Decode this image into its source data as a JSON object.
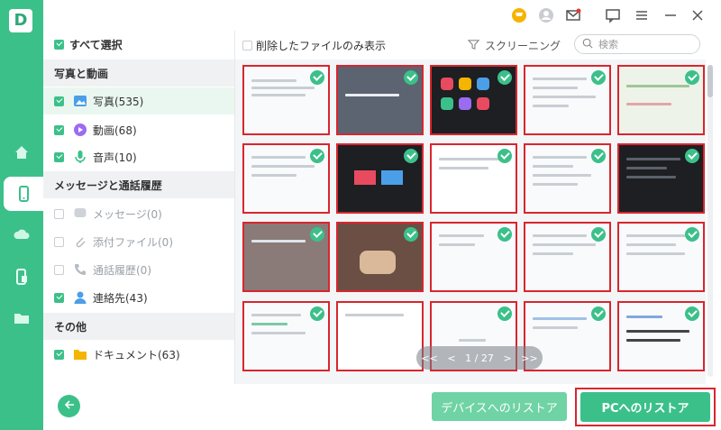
{
  "logo": "D",
  "sidebar": {
    "select_all": "すべて選択",
    "section_media": "写真と動画",
    "photos": "写真(535)",
    "videos": "動画(68)",
    "audio": "音声(10)",
    "section_messages": "メッセージと通話履歴",
    "messages": "メッセージ(0)",
    "attachments": "添付ファイル(0)",
    "call_log": "通話履歴(0)",
    "contacts": "連絡先(43)",
    "section_other": "その他",
    "documents": "ドキュメント(63)"
  },
  "filter": {
    "deleted_only": "削除したファイルのみ表示",
    "screening": "スクリーニング",
    "search_placeholder": "検索"
  },
  "pager": {
    "first": "<<",
    "prev": "<",
    "page": "1 / 27",
    "next": ">",
    "last": ">>"
  },
  "buttons": {
    "restore_device": "デバイスへのリストア",
    "restore_pc": "PCへのリストア"
  },
  "colors": {
    "accent": "#3cc08a",
    "highlight": "#d8262e"
  }
}
